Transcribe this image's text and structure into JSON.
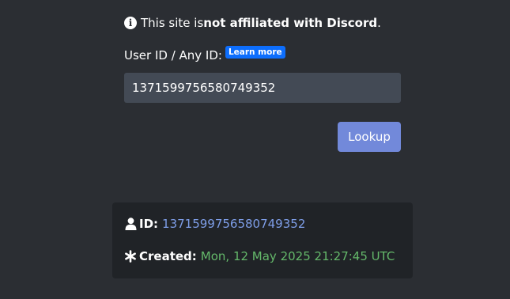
{
  "notice": {
    "prefix": "This site is ",
    "bold": "not affiliated with Discord",
    "suffix": "."
  },
  "lookup_form": {
    "label": "User ID / Any ID:",
    "learn_more": "Learn more",
    "input_value": "1371599756580749352",
    "button_label": "Lookup"
  },
  "result": {
    "id_label": "ID:",
    "id_value": "1371599756580749352",
    "created_label": "Created:",
    "created_value": "Mon, 12 May 2025 21:27:45 UTC"
  },
  "colors": {
    "background": "#2b2e33",
    "input_bg": "#434a55",
    "button_bg": "#7289da",
    "badge_bg": "#0d6efd",
    "card_bg": "#202327",
    "id_value": "#7e9ee8",
    "created_value": "#64b86a"
  },
  "icons": {
    "notice": "info-circle-icon",
    "id": "user-icon",
    "created": "asterisk-icon"
  }
}
